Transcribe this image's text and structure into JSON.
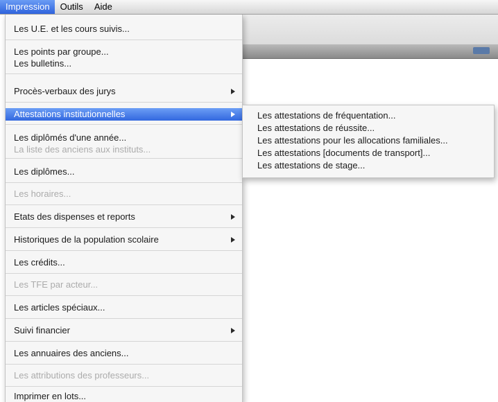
{
  "menubar": {
    "items": [
      {
        "label": "Impression",
        "active": true
      },
      {
        "label": "Outils",
        "active": false
      },
      {
        "label": "Aide",
        "active": false
      }
    ]
  },
  "menu": {
    "items": [
      {
        "label": "Les U.E. et les cours suivis...",
        "enabled": true
      },
      {
        "label": "Les points par groupe...",
        "enabled": true
      },
      {
        "label": "Les bulletins...",
        "enabled": true
      },
      {
        "label": "Procès-verbaux des jurys",
        "enabled": true,
        "submenu": true
      },
      {
        "label": "Attestations institutionnelles",
        "enabled": true,
        "submenu": true,
        "highlighted": true
      },
      {
        "label": "Les diplômés d'une année...",
        "enabled": true
      },
      {
        "label": "La liste des anciens aux instituts...",
        "enabled": false
      },
      {
        "label": "Les diplômes...",
        "enabled": true
      },
      {
        "label": "Les horaires...",
        "enabled": false
      },
      {
        "label": "Etats des dispenses et reports",
        "enabled": true,
        "submenu": true
      },
      {
        "label": "Historiques de la population scolaire",
        "enabled": true,
        "submenu": true
      },
      {
        "label": "Les crédits...",
        "enabled": true
      },
      {
        "label": "Les TFE par acteur...",
        "enabled": false
      },
      {
        "label": "Les articles spéciaux...",
        "enabled": true
      },
      {
        "label": "Suivi financier",
        "enabled": true,
        "submenu": true
      },
      {
        "label": "Les annuaires des anciens...",
        "enabled": true
      },
      {
        "label": "Les attributions des professeurs...",
        "enabled": false
      },
      {
        "label": "Imprimer en lots...",
        "enabled": true
      }
    ]
  },
  "submenu": {
    "items": [
      {
        "label": "Les attestations de fréquentation..."
      },
      {
        "label": "Les attestations de réussite..."
      },
      {
        "label": "Les attestations pour les allocations familiales..."
      },
      {
        "label": "Les attestations [documents de transport]..."
      },
      {
        "label": "Les attestations de stage..."
      }
    ]
  },
  "colors": {
    "highlight": "#3267df",
    "disabled_text": "#ababab",
    "menu_background": "#f6f6f6"
  }
}
